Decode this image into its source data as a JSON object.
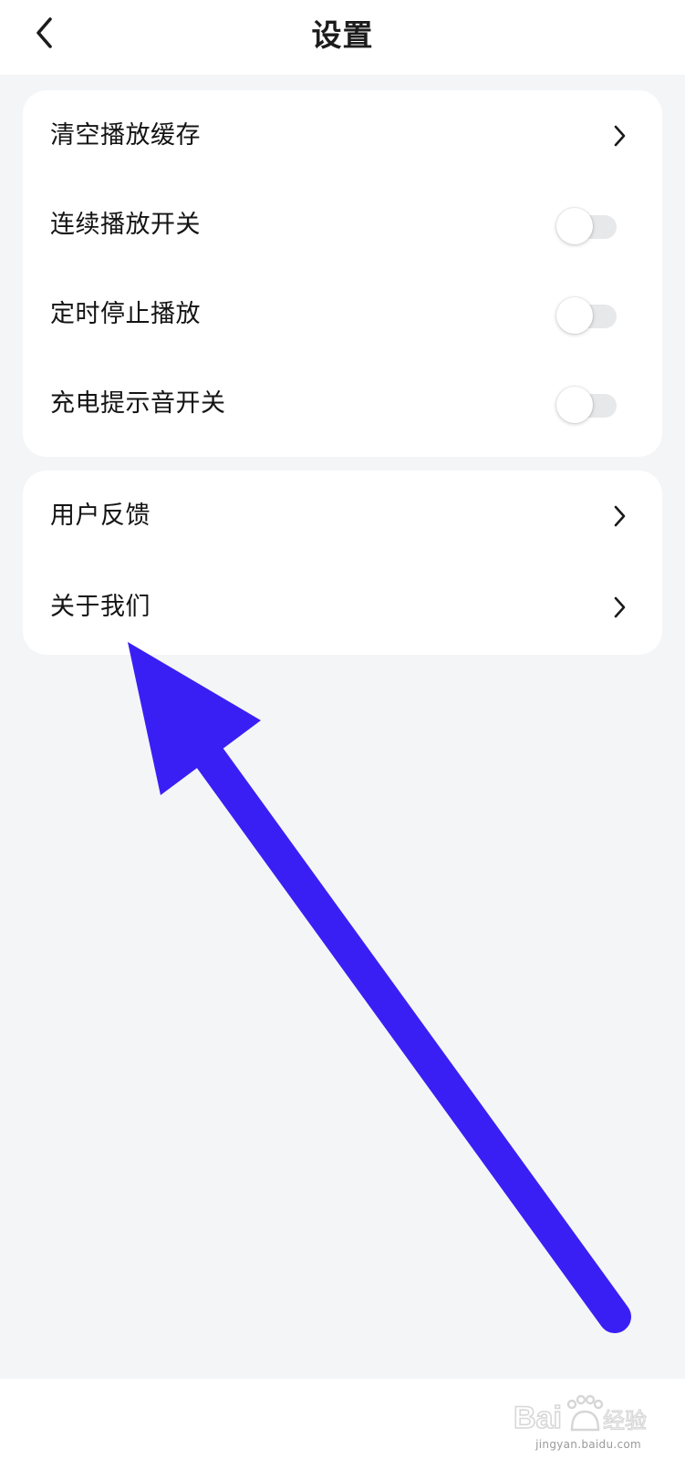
{
  "header": {
    "title": "设置",
    "back_icon": "chevron-left-icon"
  },
  "settings_group_1": {
    "items": [
      {
        "label": "清空播放缓存",
        "control": "chevron-right-icon"
      },
      {
        "label": "连续播放开关",
        "control": "toggle",
        "enabled": false
      },
      {
        "label": "定时停止播放",
        "control": "toggle",
        "enabled": false
      },
      {
        "label": "充电提示音开关",
        "control": "toggle",
        "enabled": false
      }
    ]
  },
  "settings_group_2": {
    "items": [
      {
        "label": "用户反馈",
        "control": "chevron-right-icon"
      },
      {
        "label": "关于我们",
        "control": "chevron-right-icon"
      }
    ]
  },
  "annotation": {
    "shape": "arrow",
    "color": "#3a1ff5"
  },
  "watermark": {
    "logo_text": "Bai du 经验",
    "subtext": "jingyan.baidu.com"
  },
  "colors": {
    "page_background": "#f4f5f7",
    "card_background": "#ffffff",
    "toggle_off_track": "#e7e8ea"
  }
}
